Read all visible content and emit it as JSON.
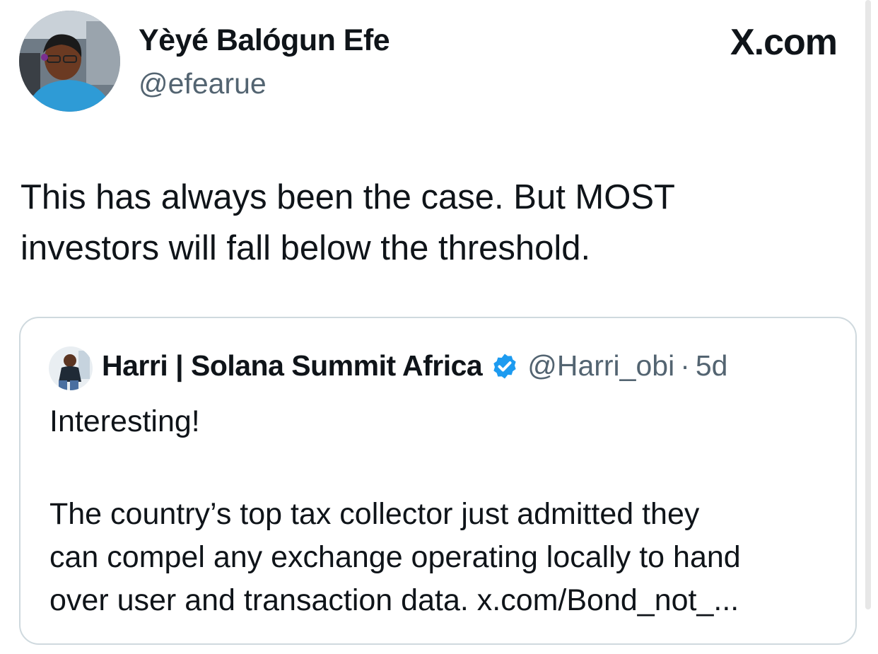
{
  "author": {
    "display_name": "Yèyé Balógun Efe",
    "handle": "@efearue"
  },
  "brand": "X.com",
  "tweet": {
    "text_line1": "This has always been the case. But MOST",
    "text_line2": "investors will fall below the threshold."
  },
  "quote": {
    "display_name": "Harri | Solana Summit Africa",
    "handle": "@Harri_obi",
    "separator": "·",
    "time": "5d",
    "verified_color": "#1d9bf0",
    "line1": "Interesting!",
    "body_line1": "The country’s top tax collector just admitted they",
    "body_line2": "can compel any exchange operating locally to hand",
    "body_line3": "over user and transaction data. x.com/Bond_not_..."
  },
  "icons": {
    "verified": "verified-badge-icon"
  }
}
